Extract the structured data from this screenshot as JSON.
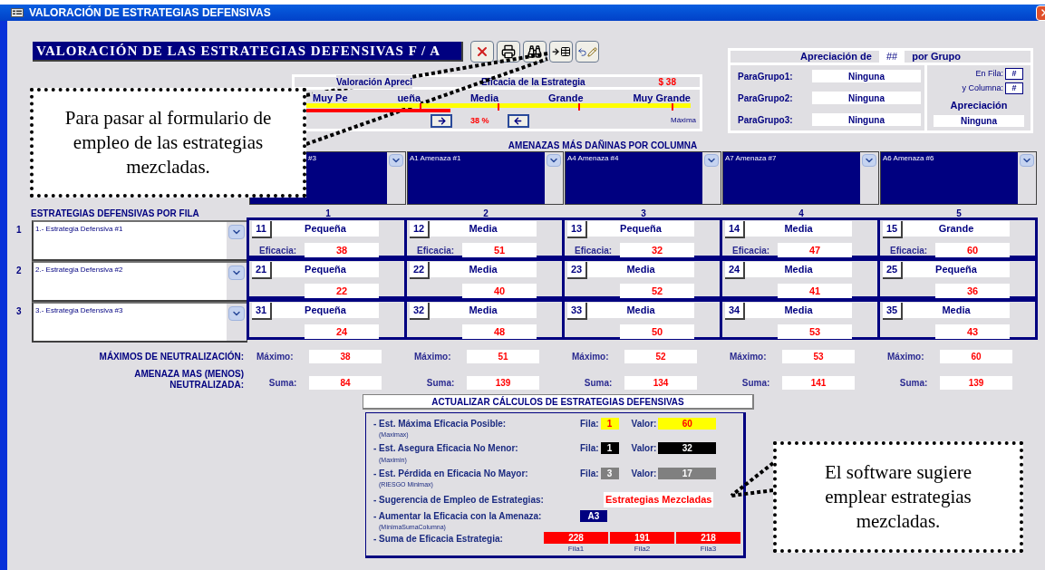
{
  "window": {
    "title": "VALORACIÓN DE ESTRATEGIAS DEFENSIVAS"
  },
  "form_title": "VALORACIÓN DE LAS ESTRATEGIAS DEFENSIVAS F / A",
  "valoracion": {
    "title": "Valoración Apreci",
    "eficacia_label": "Eficacia de la Estrategia",
    "eficacia_value": "$ 38",
    "scale": [
      "Muy Pe",
      "ueña",
      "Media",
      "Grande",
      "Muy Grande"
    ],
    "level": 0.38,
    "percent": "38 %",
    "max_label": "Máxima"
  },
  "apreciacion": {
    "title_pre": "Apreciación de",
    "code": "##",
    "title_post": "por Grupo",
    "groups": [
      {
        "label": "ParaGrupo1:",
        "value": "Ninguna"
      },
      {
        "label": "ParaGrupo2:",
        "value": "Ninguna"
      },
      {
        "label": "ParaGrupo3:",
        "value": "Ninguna"
      }
    ],
    "fila_label": "En Fila:",
    "fila": "#",
    "columna_label": "y Columna:",
    "columna": "#",
    "result_label": "Apreciación",
    "result": "Ninguna"
  },
  "amenazas": {
    "title": "AMENAZAS MÁS DAÑINAS POR COLUMNA",
    "items": [
      {
        "text": "#3",
        "partly_hidden": true
      },
      {
        "text": "A1 Amenaza #1",
        "partly_hidden": false
      },
      {
        "text": "A4 Amenaza #4",
        "partly_hidden": false
      },
      {
        "text": "A7 Amenaza #7",
        "partly_hidden": false
      },
      {
        "text": "A6 Amenaza #6",
        "partly_hidden": false
      }
    ]
  },
  "estrategias": {
    "title": "ESTRATEGIAS DEFENSIVAS POR FILA",
    "columns": [
      "1",
      "2",
      "3",
      "4",
      "5"
    ],
    "rows": [
      {
        "number": "1",
        "name": "1.- Estrategia Defensiva #1",
        "cells": [
          {
            "code": "11",
            "size": "Pequeña",
            "label": "Eficacia:",
            "value": "38"
          },
          {
            "code": "12",
            "size": "Media",
            "label": "Eficacia:",
            "value": "51"
          },
          {
            "code": "13",
            "size": "Pequeña",
            "label": "Eficacia:",
            "value": "32"
          },
          {
            "code": "14",
            "size": "Media",
            "label": "Eficacia:",
            "value": "47"
          },
          {
            "code": "15",
            "size": "Grande",
            "label": "Eficacia:",
            "value": "60"
          }
        ]
      },
      {
        "number": "2",
        "name": "2.- Estrategia Defensiva #2",
        "cells": [
          {
            "code": "21",
            "size": "Pequeña",
            "value": "22"
          },
          {
            "code": "22",
            "size": "Media",
            "value": "40"
          },
          {
            "code": "23",
            "size": "Media",
            "value": "52"
          },
          {
            "code": "24",
            "size": "Media",
            "value": "41"
          },
          {
            "code": "25",
            "size": "Pequeña",
            "value": "36"
          }
        ]
      },
      {
        "number": "3",
        "name": "3.- Estrategia Defensiva #3",
        "cells": [
          {
            "code": "31",
            "size": "Pequeña",
            "value": "24"
          },
          {
            "code": "32",
            "size": "Media",
            "value": "48"
          },
          {
            "code": "33",
            "size": "Media",
            "value": "50"
          },
          {
            "code": "34",
            "size": "Media",
            "value": "53"
          },
          {
            "code": "35",
            "size": "Media",
            "value": "43"
          }
        ]
      }
    ]
  },
  "maximos": {
    "label": "MÁXIMOS DE NEUTRALIZACIÓN:",
    "items": [
      {
        "label": "Máximo:",
        "value": "38"
      },
      {
        "label": "Máximo:",
        "value": "51"
      },
      {
        "label": "Máximo:",
        "value": "52"
      },
      {
        "label": "Máximo:",
        "value": "53"
      },
      {
        "label": "Máximo:",
        "value": "60"
      }
    ]
  },
  "sumas": {
    "label_lines": [
      "AMENAZA MAS (MENOS)",
      "NEUTRALIZADA:"
    ],
    "items": [
      {
        "label": "Suma:",
        "value": "84"
      },
      {
        "label": "Suma:",
        "value": "139"
      },
      {
        "label": "Suma:",
        "value": "134"
      },
      {
        "label": "Suma:",
        "value": "141"
      },
      {
        "label": "Suma:",
        "value": "139"
      }
    ]
  },
  "calculos": {
    "title": "ACTUALIZAR CÁLCULOS DE ESTRATEGIAS DEFENSIVAS",
    "rows": [
      {
        "kind": "fila_valor",
        "label": "- Est.  Máxima Eficacia Posible:",
        "sub": "(Maximax)",
        "fila_label": "Fila:",
        "fila": "1",
        "valor_label": "Valor:",
        "valor": "60",
        "color": "#ffff00"
      },
      {
        "kind": "fila_valor",
        "label": "- Est.  Asegura Eficacia No Menor:",
        "sub": "(Maximin)",
        "fila_label": "Fila:",
        "fila": "1",
        "valor_label": "Valor:",
        "valor": "32",
        "color": "#000000"
      },
      {
        "kind": "fila_valor",
        "label": "- Est.  Pérdida en Eficacia No Mayor:",
        "sub": "(RIESGO Minimax)",
        "fila_label": "Fila:",
        "fila": "3",
        "valor_label": "Valor:",
        "valor": "17",
        "color": "#808080"
      },
      {
        "kind": "suggestion",
        "label": "- Sugerencia de Empleo de Estrategias:",
        "value": "Estrategias Mezcladas"
      },
      {
        "kind": "threat",
        "label": "- Aumentar la Eficacia con la Amenaza:",
        "sub": "(MínimaSumaColumna)",
        "value": "A3"
      },
      {
        "kind": "sums",
        "label": "- Suma de Eficacia Estrategia:",
        "values": [
          "228",
          "191",
          "218"
        ],
        "captions": [
          "Fila1",
          "Fila2",
          "Fila3"
        ]
      }
    ]
  },
  "callouts": [
    {
      "text": "Para pasar al formulario de empleo de las estrategias mezcladas."
    },
    {
      "text": "El software sugiere emplear estrategias mezcladas."
    }
  ]
}
